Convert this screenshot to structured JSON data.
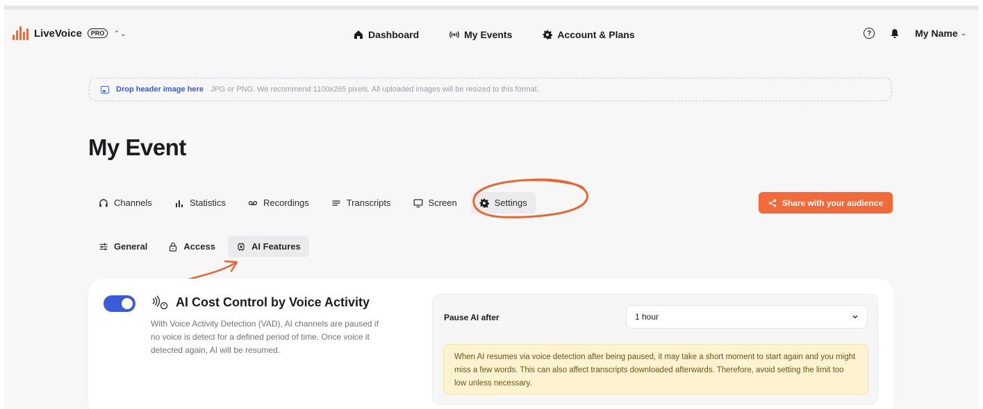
{
  "app": {
    "name": "LiveVoice",
    "badge": "PRO",
    "switcher_glyph": "⌃⌄",
    "brand_color": "#f26a3a"
  },
  "nav": {
    "items": [
      {
        "label": "Dashboard",
        "icon": "home-icon"
      },
      {
        "label": "My Events",
        "icon": "broadcast-icon"
      },
      {
        "label": "Account & Plans",
        "icon": "gear-icon"
      }
    ]
  },
  "user": {
    "help_glyph": "?",
    "name": "My Name",
    "chevron": "⌄"
  },
  "dropzone": {
    "label": "Drop header image here",
    "hint": "JPG or PNG. We recommend 1100x265 pixels. All uploaded images will be resized to this format."
  },
  "event": {
    "title": "My Event"
  },
  "tabs": [
    {
      "label": "Channels",
      "icon": "headphones-icon"
    },
    {
      "label": "Statistics",
      "icon": "bar-chart-icon"
    },
    {
      "label": "Recordings",
      "icon": "voicemail-icon"
    },
    {
      "label": "Transcripts",
      "icon": "lines-icon"
    },
    {
      "label": "Screen",
      "icon": "monitor-icon"
    },
    {
      "label": "Settings",
      "icon": "gear-icon",
      "active": true
    }
  ],
  "share_button": {
    "label": "Share with your audience",
    "icon": "share-icon"
  },
  "subtabs": [
    {
      "label": "General",
      "icon": "sliders-icon"
    },
    {
      "label": "Access",
      "icon": "lock-icon"
    },
    {
      "label": "AI Features",
      "icon": "chip-icon",
      "active": true
    }
  ],
  "feature": {
    "enabled": true,
    "title": "AI Cost Control by Voice Activity",
    "description": "With Voice Activity Detection (VAD), AI channels are paused if no voice is detect for a defined period of time. Once voice it detected again, AI will be resumed.",
    "pause_label": "Pause AI after",
    "pause_value": "1 hour",
    "warning": "When AI resumes via voice detection after being paused, it may take a short moment to start again and you might miss a few words. This can also affect transcripts downloaded afterwards. Therefore, avoid setting the limit too low unless necessary."
  },
  "colors": {
    "accent": "#f26a3a",
    "toggle_on": "#3b5bdb",
    "link": "#3a5bd9",
    "warning_bg": "#fdf3d1",
    "annotation": "#e8662f"
  }
}
